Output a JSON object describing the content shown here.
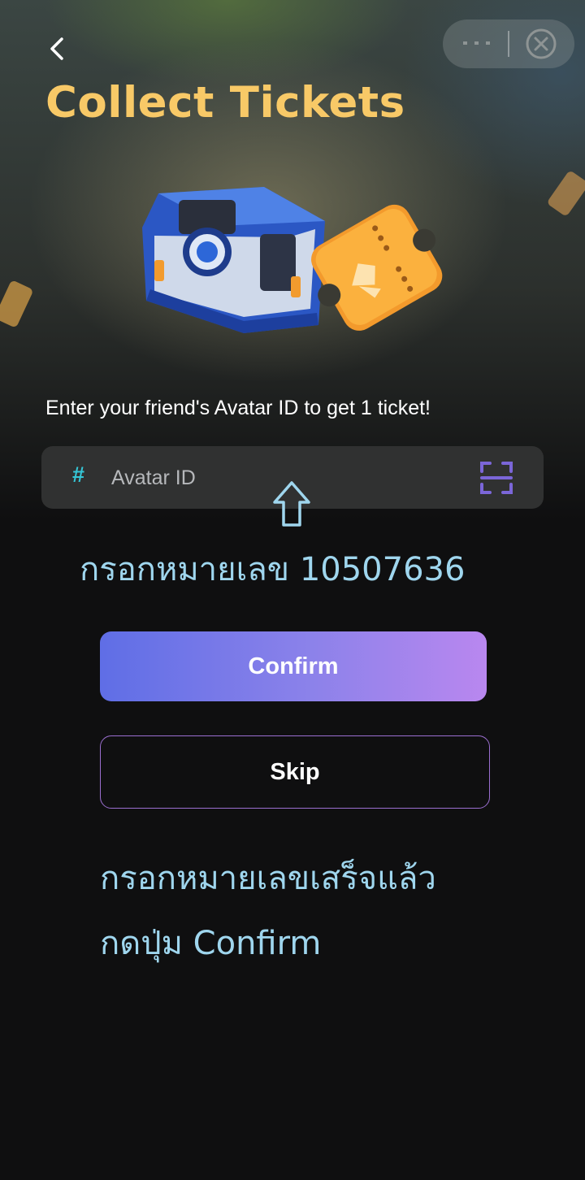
{
  "header": {
    "title": "Collect Tickets",
    "back_icon": "chevron-left-icon",
    "menu_icon": "more-dots-icon",
    "close_icon": "close-circle-icon"
  },
  "hero": {
    "image": "treasure-chest-and-ticket"
  },
  "form": {
    "prompt": "Enter your friend's Avatar ID to get 1 ticket!",
    "prefix": "#",
    "placeholder": "Avatar ID",
    "value": "",
    "scan_icon": "scan-icon"
  },
  "annotations": {
    "arrow_icon": "arrow-up-outline-icon",
    "line1": "กรอกหมายเลข 10507636",
    "line2": "กรอกหมายเลขเสร็จแล้ว",
    "line3": "กดปุ่ม Confirm"
  },
  "actions": {
    "confirm_label": "Confirm",
    "skip_label": "Skip"
  },
  "colors": {
    "title": "#f8c967",
    "accent_start": "#5f6ee6",
    "accent_end": "#b987ef",
    "annotation": "#9fd6ee",
    "background": "#0f0f10"
  }
}
